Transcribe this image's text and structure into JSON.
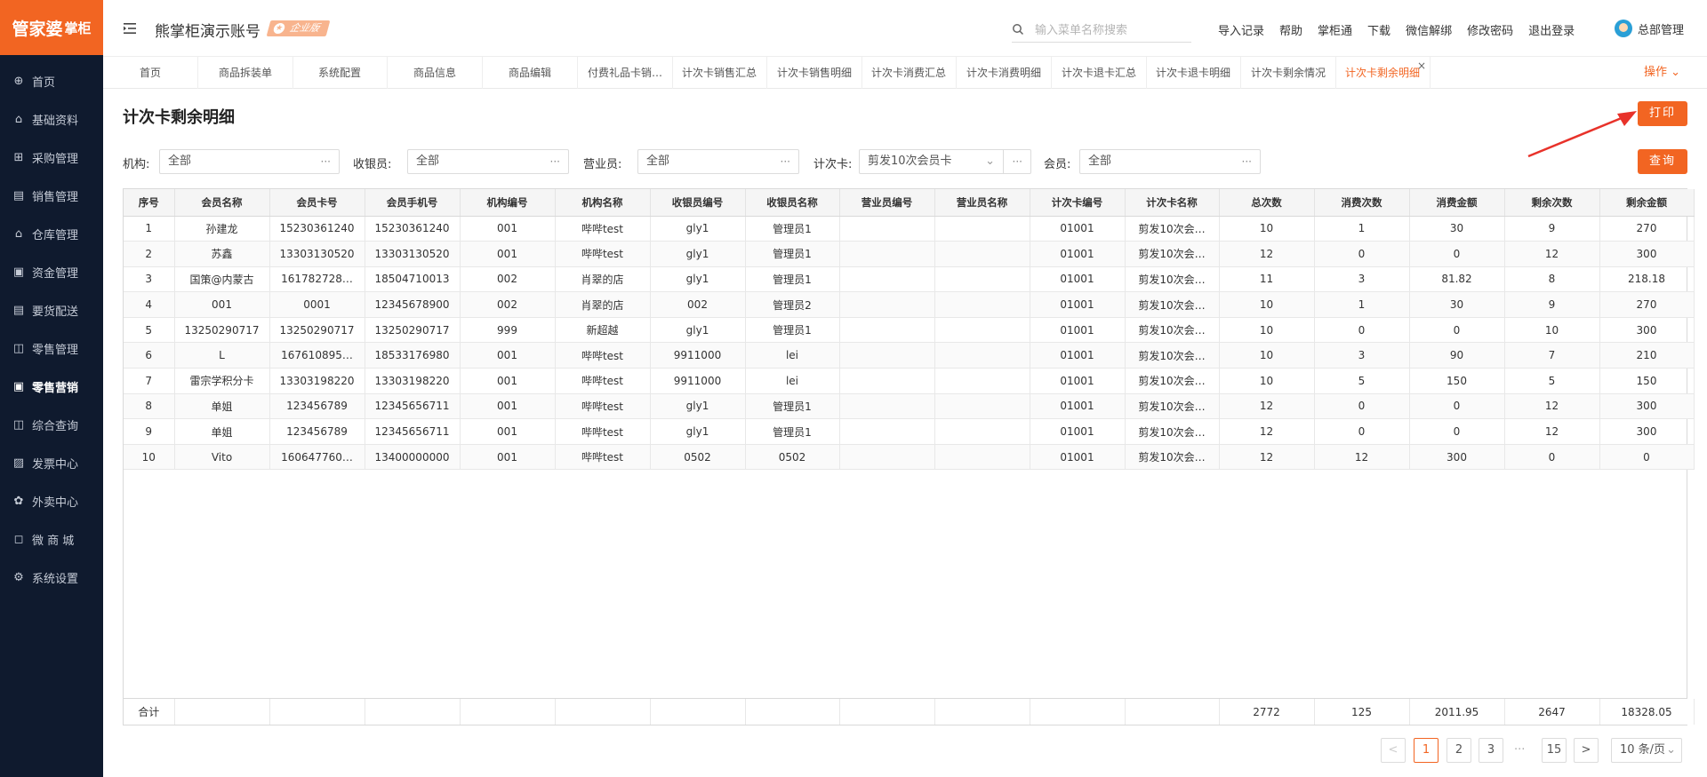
{
  "logo": {
    "main": "管家婆",
    "sub": "掌柜"
  },
  "sidebar": {
    "items": [
      {
        "label": "首页",
        "icon": "globe-icon"
      },
      {
        "label": "基础资料",
        "icon": "home-icon"
      },
      {
        "label": "采购管理",
        "icon": "cart-icon"
      },
      {
        "label": "销售管理",
        "icon": "sales-icon"
      },
      {
        "label": "仓库管理",
        "icon": "warehouse-icon"
      },
      {
        "label": "资金管理",
        "icon": "fund-icon"
      },
      {
        "label": "要货配送",
        "icon": "delivery-icon"
      },
      {
        "label": "零售管理",
        "icon": "chart-icon"
      },
      {
        "label": "零售营销",
        "icon": "gift-icon"
      },
      {
        "label": "综合查询",
        "icon": "bar-chart-icon"
      },
      {
        "label": "发票中心",
        "icon": "invoice-icon"
      },
      {
        "label": "外卖中心",
        "icon": "takeout-icon"
      },
      {
        "label": "微 商 城",
        "icon": "shop-icon"
      },
      {
        "label": "系统设置",
        "icon": "gear-icon"
      }
    ],
    "active_index": 8
  },
  "header": {
    "account": "熊掌柜演示账号",
    "badge": "企业版",
    "search_placeholder": "输入菜单名称搜索",
    "links": [
      "导入记录",
      "帮助",
      "掌柜通",
      "下载",
      "微信解绑",
      "修改密码",
      "退出登录"
    ],
    "user": "总部管理"
  },
  "tabs": {
    "items": [
      "首页",
      "商品拆装单",
      "系统配置",
      "商品信息",
      "商品编辑",
      "付费礼品卡销…",
      "计次卡销售汇总",
      "计次卡销售明细",
      "计次卡消费汇总",
      "计次卡消费明细",
      "计次卡退卡汇总",
      "计次卡退卡明细",
      "计次卡剩余情况",
      "计次卡剩余明细"
    ],
    "active_index": 13,
    "ops_label": "操作"
  },
  "page": {
    "title": "计次卡剩余明细",
    "print_label": "打印",
    "query_label": "查询"
  },
  "filters": {
    "org_label": "机构:",
    "org_value": "全部",
    "cashier_label": "收银员:",
    "cashier_value": "全部",
    "clerk_label": "营业员:",
    "clerk_value": "全部",
    "card_label": "计次卡:",
    "card_value": "剪发10次会员卡",
    "member_label": "会员:",
    "member_value": "全部"
  },
  "table": {
    "columns": [
      "序号",
      "会员名称",
      "会员卡号",
      "会员手机号",
      "机构编号",
      "机构名称",
      "收银员编号",
      "收银员名称",
      "营业员编号",
      "营业员名称",
      "计次卡编号",
      "计次卡名称",
      "总次数",
      "消费次数",
      "消费金额",
      "剩余次数",
      "剩余金额"
    ],
    "rows": [
      [
        "1",
        "孙建龙",
        "15230361240",
        "15230361240",
        "001",
        "哔哔test",
        "gly1",
        "管理员1",
        "",
        "",
        "01001",
        "剪发10次会…",
        "10",
        "1",
        "30",
        "9",
        "270"
      ],
      [
        "2",
        "苏鑫",
        "13303130520",
        "13303130520",
        "001",
        "哔哔test",
        "gly1",
        "管理员1",
        "",
        "",
        "01001",
        "剪发10次会…",
        "12",
        "0",
        "0",
        "12",
        "300"
      ],
      [
        "3",
        "国策@内蒙古",
        "161782728…",
        "18504710013",
        "002",
        "肖翠的店",
        "gly1",
        "管理员1",
        "",
        "",
        "01001",
        "剪发10次会…",
        "11",
        "3",
        "81.82",
        "8",
        "218.18"
      ],
      [
        "4",
        "001",
        "0001",
        "12345678900",
        "002",
        "肖翠的店",
        "002",
        "管理员2",
        "",
        "",
        "01001",
        "剪发10次会…",
        "10",
        "1",
        "30",
        "9",
        "270"
      ],
      [
        "5",
        "13250290717",
        "13250290717",
        "13250290717",
        "999",
        "新超越",
        "gly1",
        "管理员1",
        "",
        "",
        "01001",
        "剪发10次会…",
        "10",
        "0",
        "0",
        "10",
        "300"
      ],
      [
        "6",
        "L",
        "167610895…",
        "18533176980",
        "001",
        "哔哔test",
        "9911000",
        "lei",
        "",
        "",
        "01001",
        "剪发10次会…",
        "10",
        "3",
        "90",
        "7",
        "210"
      ],
      [
        "7",
        "雷宗学积分卡",
        "13303198220",
        "13303198220",
        "001",
        "哔哔test",
        "9911000",
        "lei",
        "",
        "",
        "01001",
        "剪发10次会…",
        "10",
        "5",
        "150",
        "5",
        "150"
      ],
      [
        "8",
        "单姐",
        "123456789",
        "12345656711",
        "001",
        "哔哔test",
        "gly1",
        "管理员1",
        "",
        "",
        "01001",
        "剪发10次会…",
        "12",
        "0",
        "0",
        "12",
        "300"
      ],
      [
        "9",
        "单姐",
        "123456789",
        "12345656711",
        "001",
        "哔哔test",
        "gly1",
        "管理员1",
        "",
        "",
        "01001",
        "剪发10次会…",
        "12",
        "0",
        "0",
        "12",
        "300"
      ],
      [
        "10",
        "Vito",
        "160647760…",
        "13400000000",
        "001",
        "哔哔test",
        "0502",
        "0502",
        "",
        "",
        "01001",
        "剪发10次会…",
        "12",
        "12",
        "300",
        "0",
        "0"
      ]
    ],
    "footer": [
      "合计",
      "",
      "",
      "",
      "",
      "",
      "",
      "",
      "",
      "",
      "",
      "",
      "2772",
      "125",
      "2011.95",
      "2647",
      "18328.05"
    ]
  },
  "pagination": {
    "prev": "<",
    "pages": [
      "1",
      "2",
      "3"
    ],
    "dots": "···",
    "last": "15",
    "next": ">",
    "current": "1",
    "page_size": "10 条/页"
  },
  "colors": {
    "accent": "#f26522",
    "sidebar_bg": "#0f1a2e"
  }
}
